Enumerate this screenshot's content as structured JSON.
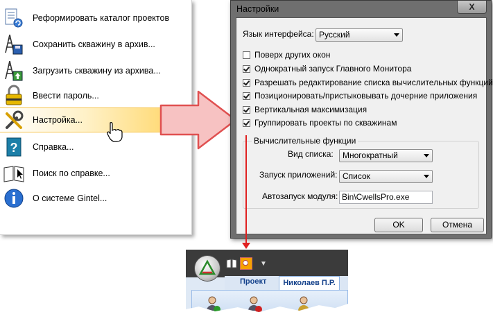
{
  "menu": {
    "items": [
      {
        "label": "Реформировать каталог проектов",
        "icon": "catalog-icon"
      },
      {
        "label": "Сохранить скважину в архив...",
        "icon": "rig-save-icon"
      },
      {
        "label": "Загрузить скважину из архива...",
        "icon": "rig-load-icon"
      },
      {
        "label": "Ввести пароль...",
        "icon": "lock-icon"
      },
      {
        "label": "Настройка...",
        "icon": "tools-icon",
        "highlighted": true
      },
      {
        "label": "Справка...",
        "icon": "help-book-icon"
      },
      {
        "label": "Поиск по справке...",
        "icon": "help-search-icon"
      },
      {
        "label": "О системе Gintel...",
        "icon": "info-icon"
      }
    ]
  },
  "dialog": {
    "title": "Настройки",
    "close": "X",
    "language_label": "Язык интерфейса:",
    "language_value": "Русский",
    "checkboxes": [
      {
        "label": "Поверх других окон",
        "checked": false
      },
      {
        "label": "Однократный  запуск Главного Монитора",
        "checked": true
      },
      {
        "label": "Разрешать редактирование списка вычислительных функций",
        "checked": true
      },
      {
        "label": "Позиционировать/пристыковывать дочерние приложения",
        "checked": true
      },
      {
        "label": "Вертикальная максимизация",
        "checked": true
      },
      {
        "label": "Группировать проекты по скважинам",
        "checked": true
      }
    ],
    "group": {
      "title": "Вычислительные функции",
      "list_view_label": "Вид списка:",
      "list_view_value": "Многократный",
      "app_launch_label": "Запуск приложений:",
      "app_launch_value": "Список",
      "autostart_label": "Автозапуск модуля:",
      "autostart_value": "Bin\\CwellsPro.exe"
    },
    "ok_label": "OK",
    "cancel_label": "Отмена"
  },
  "toolbar": {
    "tabs": [
      "Проект",
      "Николаев П.Р."
    ]
  },
  "colors": {
    "highlight": "#ffd35c",
    "arrow_fill": "#f7c2c2",
    "arrow_stroke": "#e05050",
    "connector": "#e02020",
    "dialog_frame": "#6f6f6f"
  }
}
